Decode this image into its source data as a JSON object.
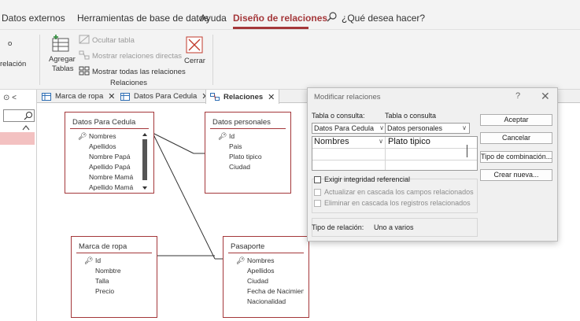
{
  "ribbon": {
    "tabs": [
      "Datos externos",
      "Herramientas de base de datos",
      "Ayuda",
      "Diseño de relaciones"
    ],
    "active_tab": "Diseño de relaciones",
    "tell_me": "¿Qué desea hacer?",
    "left_cut_1": "o",
    "left_cut_2": "relación",
    "add_tables_line1": "Agregar",
    "add_tables_line2": "Tablas",
    "hide_table": "Ocultar tabla",
    "direct_relations": "Mostrar relaciones directas",
    "all_relations": "Mostrar todas las relaciones",
    "group_label": "Relaciones",
    "close_label": "Cerrar",
    "accent_color": "#a4373a"
  },
  "navpane": {
    "chevron": "⊙ <",
    "search_icon": "search-icon"
  },
  "doc_tabs": [
    {
      "label": "Marca de ropa",
      "icon": "table-icon"
    },
    {
      "label": "Datos Para Cedula",
      "icon": "table-icon"
    },
    {
      "label": "Relaciones",
      "icon": "relationships-icon",
      "active": true
    }
  ],
  "tables": {
    "datos_para_cedula": {
      "title": "Datos Para Cedula",
      "fields": [
        "Nombres",
        "Apellidos",
        "Nombre Papá",
        "Apellido Papá",
        "Nombre Mamá",
        "Apellido Mamá"
      ]
    },
    "datos_personales": {
      "title": "Datos personales",
      "fields": [
        "Id",
        "Pais",
        "Plato tipico",
        "Ciudad"
      ]
    },
    "marca_de_ropa": {
      "title": "Marca de ropa",
      "fields": [
        "Id",
        "Nombtre",
        "Talla",
        "Precio"
      ]
    },
    "pasaporte": {
      "title": "Pasaporte",
      "fields": [
        "Nombres",
        "Apellidos",
        "Ciudad",
        "Fecha de Nacimiento",
        "Nacionalidad"
      ]
    }
  },
  "dialog": {
    "title": "Modificar relaciones",
    "help": "?",
    "close": "✕",
    "table_label": "Tabla o consulta:",
    "related_label": "Tabla o consulta",
    "table_value": "Datos Para Cedula",
    "related_value": "Datos personales",
    "field_left": "Nombres",
    "field_right": "Plato tipico",
    "enforce": "Exigir integridad referencial",
    "cascade_update": "Actualizar en cascada los campos relacionados",
    "cascade_delete": "Eliminar en cascada los registros relacionados",
    "relation_type_label": "Tipo de relación:",
    "relation_type_value": "Uno a varios",
    "buttons": {
      "accept": "Aceptar",
      "cancel": "Cancelar",
      "join_type": "Tipo de combinación...",
      "create_new": "Crear nueva..."
    }
  }
}
